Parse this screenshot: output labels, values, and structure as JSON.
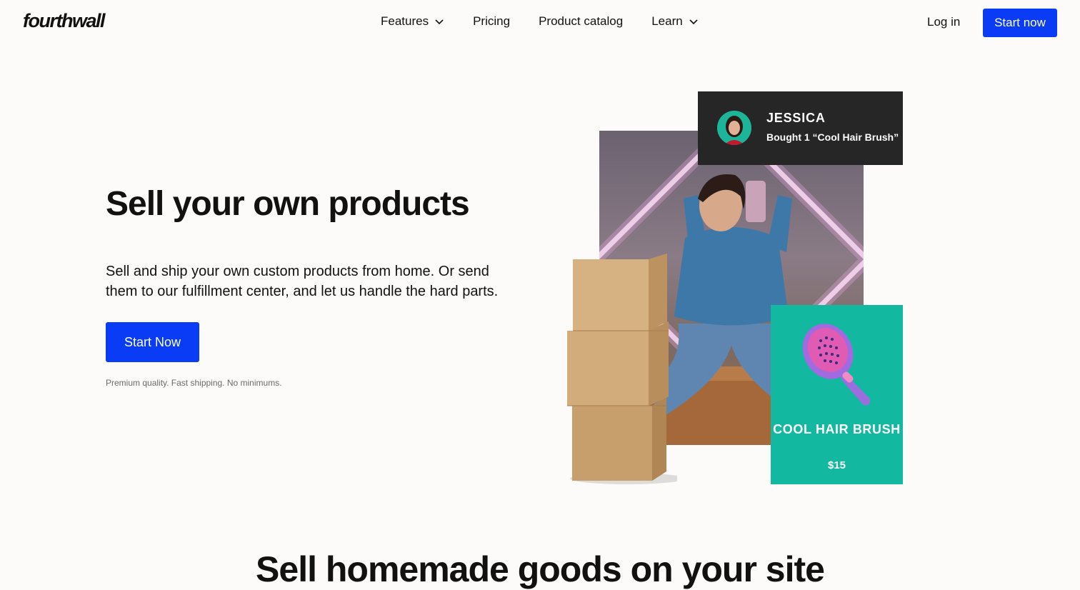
{
  "header": {
    "logo": "fourthwall",
    "nav": [
      {
        "label": "Features",
        "has_dropdown": true
      },
      {
        "label": "Pricing",
        "has_dropdown": false
      },
      {
        "label": "Product catalog",
        "has_dropdown": false
      },
      {
        "label": "Learn",
        "has_dropdown": true
      }
    ],
    "login_label": "Log in",
    "cta_label": "Start now"
  },
  "hero": {
    "title": "Sell your own products",
    "subtitle": "Sell and ship your own custom products from home. Or send them to our fulfillment center, and let us handle the hard parts.",
    "cta_label": "Start Now",
    "note": "Premium quality. Fast shipping. No minimums."
  },
  "purchase_card": {
    "name": "JESSICA",
    "text": "Bought 1 “Cool Hair Brush”"
  },
  "product_card": {
    "name": "COOL HAIR BRUSH",
    "price": "$15"
  },
  "section2": {
    "title": "Sell homemade goods on your site"
  },
  "colors": {
    "accent": "#0a3cf5",
    "background": "#fcfbf9",
    "product_card": "#12b8a0",
    "purchase_card": "#262626"
  }
}
